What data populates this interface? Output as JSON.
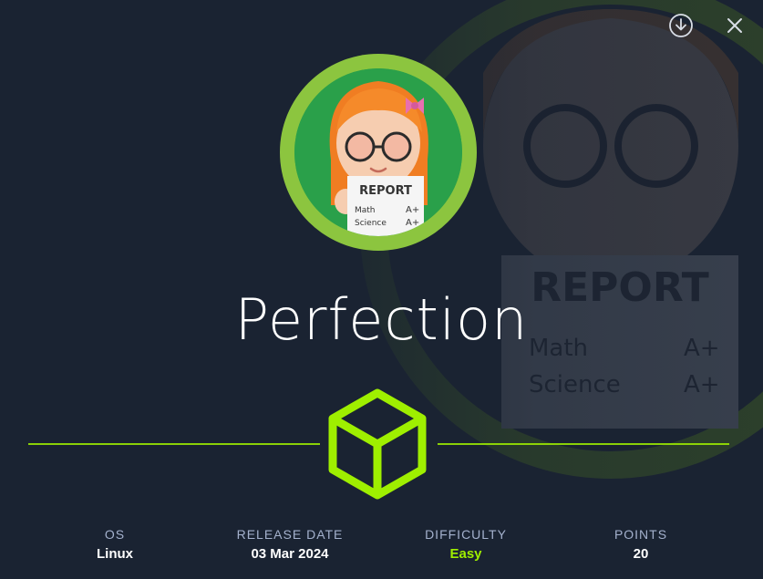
{
  "machine": {
    "name": "Perfection",
    "avatar": {
      "paper_title": "REPORT",
      "rows": [
        {
          "subject": "Math",
          "grade": "A+"
        },
        {
          "subject": "Science",
          "grade": "A+"
        }
      ]
    }
  },
  "toolbar": {
    "download_icon": "download-circle-icon",
    "close_icon": "close-icon"
  },
  "stats": [
    {
      "label": "OS",
      "value": "Linux"
    },
    {
      "label": "RELEASE DATE",
      "value": "03 Mar 2024"
    },
    {
      "label": "DIFFICULTY",
      "value": "Easy"
    },
    {
      "label": "POINTS",
      "value": "20"
    }
  ],
  "colors": {
    "background": "#1a2332",
    "accent": "#9fef00",
    "avatar_ring": "#8cc53f",
    "label": "#a4b1cd"
  }
}
